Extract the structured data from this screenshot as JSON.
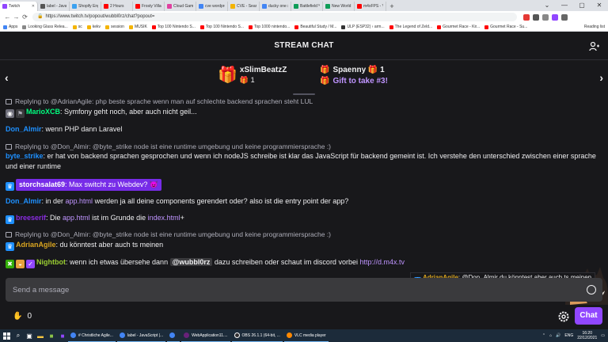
{
  "browser": {
    "tabs": [
      {
        "label": "Twitch",
        "color": "#9146ff",
        "active": true
      },
      {
        "label": "label - Javasc",
        "color": "#555"
      },
      {
        "label": "Shopify Engi",
        "color": "#3ba1f0"
      },
      {
        "label": "2 Hours",
        "color": "#ff0000"
      },
      {
        "label": "Frosty Village",
        "color": "#ff0000"
      },
      {
        "label": "Cloud Gamin",
        "color": "#e040a0"
      },
      {
        "label": "cve wordpre",
        "color": "#4285f4"
      },
      {
        "label": "CVE - Search",
        "color": "#f4b400"
      },
      {
        "label": "ducky one s",
        "color": "#4285f4"
      },
      {
        "label": "Battlefield™",
        "color": "#0f9d58"
      },
      {
        "label": "New World",
        "color": "#0f9d58"
      },
      {
        "label": "m4xFPS - Yo",
        "color": "#ff0000"
      }
    ],
    "new_tab": "+",
    "win_controls": [
      "⌄",
      "—",
      "▢",
      "✕"
    ],
    "nav": {
      "back": "←",
      "forward": "→",
      "reload": "⟳"
    },
    "url": "https://www.twitch.tv/popout/wubbl0rz/chat?popout=",
    "bookmarks": [
      {
        "label": "Apps",
        "color": "#4285f4"
      },
      {
        "label": "Looking Glass Relea...",
        "color": "#888"
      },
      {
        "label": "sc",
        "color": "#f4b400"
      },
      {
        "label": "kekv",
        "color": "#f4b400"
      },
      {
        "label": "session",
        "color": "#f4b400"
      },
      {
        "label": "MUSIK",
        "color": "#f4b400"
      },
      {
        "label": "Top 100 Nintendo S...",
        "color": "#ff0000"
      },
      {
        "label": "Top 100 Nintendo S...",
        "color": "#ff0000"
      },
      {
        "label": "Top 1000 nintendo...",
        "color": "#ff0000"
      },
      {
        "label": "Beautiful Study / M...",
        "color": "#ff0000"
      },
      {
        "label": "ULP (ESP32) › arm...",
        "color": "#333"
      },
      {
        "label": "The Legend of Zeld...",
        "color": "#ff0000"
      },
      {
        "label": "Gourmet Race - Kir...",
        "color": "#ff0000"
      },
      {
        "label": "Gourmet Race - Su...",
        "color": "#ff0000"
      }
    ],
    "reading_list": "Reading list"
  },
  "chat": {
    "header_title": "STREAM CHAT",
    "gift1": {
      "name": "xSlimBeatzZ",
      "count": "1"
    },
    "gift2": {
      "name": "Spaenny",
      "count": "1",
      "subtitle": "Gift to take #3!"
    },
    "nav_left": "‹",
    "nav_right": "›",
    "messages": {
      "r1": "Replying to @AdrianAgile: php beste sprache wenn man auf schlechte backend sprachen steht LUL",
      "m1_user": "MarioXCB",
      "m1_text": ": Symfony geht noch, aber auch nicht geil...",
      "m2_user": "Don_Almir",
      "m2_text": ": wenn PHP dann Laravel",
      "r2": "Replying to @Don_Almir: @byte_strike node ist eine runtime umgebung und keine programmiersprache :)",
      "m3_user": "byte_strike",
      "m3_text": ": er hat von backend sprachen gesprochen und wenn ich nodeJS schreibe ist klar das JavaScript für backend gemeint ist. Ich verstehe den unterschied zwischen einer sprache und einer runtime",
      "m4_user": "storchsalat69",
      "m4_text": ": Max switcht zu Webdev?",
      "m5_user": "Don_Almir",
      "m5_text_a": ": in der ",
      "m5_link": "app.html",
      "m5_text_b": " werden ja all deine components gerendert oder? also ist die entry point der app?",
      "m6_user": "breeserif",
      "m6_text_a": ": Die ",
      "m6_link1": "app.html",
      "m6_text_b": " ist im Grunde die ",
      "m6_link2": "index.html",
      "m6_text_c": "+",
      "r3": "Replying to @Don_Almir: @byte_strike node ist eine runtime umgebung und keine programmiersprache :)",
      "m7_user": "AdrianAgile",
      "m7_text": ": du könntest aber auch ts meinen",
      "m8_user": "Nightbot",
      "m8_text_a": ": wenn ich etwas übersehe dann ",
      "m8_mention": "@wubbl0rz",
      "m8_text_b": " dazu schreiben oder schaut im discord vorbei ",
      "m8_link": "http://d.m4x.tv"
    },
    "toast_user": "AdrianAgile",
    "toast_text": ": @Don_Almir du könntest aber auch ts meinen",
    "input_placeholder": "Send a message",
    "points": "0",
    "chat_button": "Chat"
  },
  "taskbar": {
    "apps": [
      {
        "label": "# Christliche Agile...",
        "color": "#4285f4"
      },
      {
        "label": "label - JavaScript |...",
        "color": "#4285f4"
      },
      {
        "label": "",
        "color": "#4285f4"
      },
      {
        "label": "WebApplication11....",
        "color": "#68217a"
      },
      {
        "label": "OBS 26.1.1 (64-bit, ...",
        "color": "#302e31"
      },
      {
        "label": "VLC media player",
        "color": "#ff8800"
      }
    ],
    "lang": "ENG",
    "time": "16:20",
    "date": "22/12/2021"
  }
}
